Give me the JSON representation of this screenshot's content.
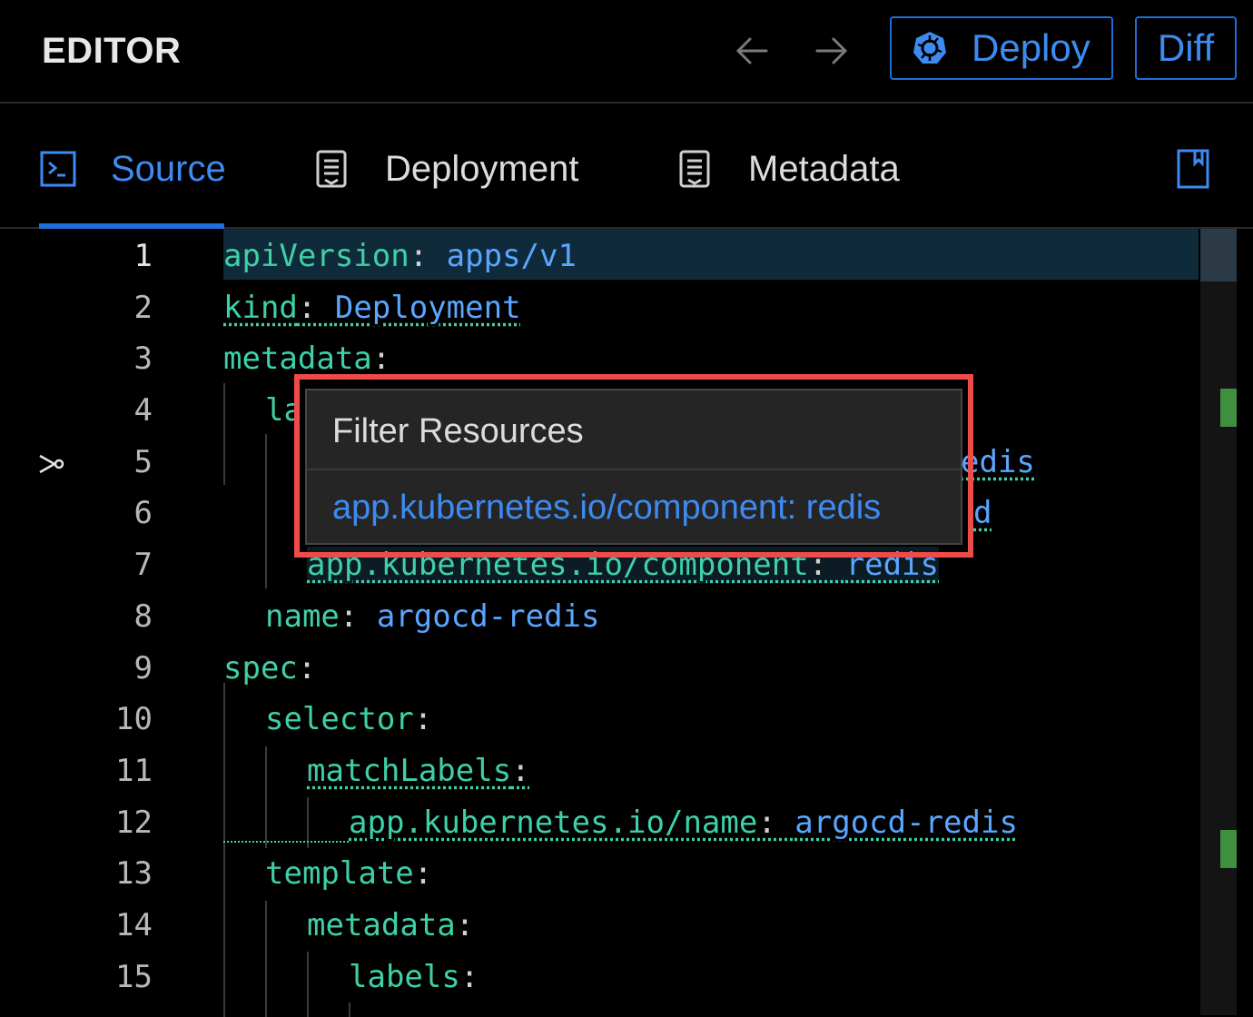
{
  "header": {
    "title": "EDITOR",
    "deploy_label": "Deploy",
    "diff_label": "Diff",
    "accent": "#1e6fd9"
  },
  "tabs": [
    {
      "label": "Source",
      "icon": "terminal-icon",
      "active": true
    },
    {
      "label": "Deployment",
      "icon": "document-icon",
      "active": false
    },
    {
      "label": "Metadata",
      "icon": "document-icon",
      "active": false
    }
  ],
  "editor": {
    "lines": [
      {
        "num": "1",
        "key": "apiVersion",
        "sep": ": ",
        "val": "apps/v1"
      },
      {
        "num": "2",
        "key": "kind",
        "sep": ": ",
        "val": "Deployment"
      },
      {
        "num": "3",
        "key": "metadata",
        "sep": ":",
        "val": ""
      },
      {
        "num": "4",
        "key": "la",
        "sep": "",
        "val": ""
      },
      {
        "num": "5",
        "key": "",
        "sep": "",
        "val": "edis"
      },
      {
        "num": "6",
        "key": "",
        "sep": "",
        "val": "d"
      },
      {
        "num": "7",
        "key": "app.kubernetes.io/component",
        "sep": ": ",
        "val": "redis"
      },
      {
        "num": "8",
        "key": "name",
        "sep": ": ",
        "val": "argocd-redis"
      },
      {
        "num": "9",
        "key": "spec",
        "sep": ":",
        "val": ""
      },
      {
        "num": "10",
        "key": "selector",
        "sep": ":",
        "val": ""
      },
      {
        "num": "11",
        "key": "matchLabels",
        "sep": ":",
        "val": ""
      },
      {
        "num": "12",
        "key": "app.kubernetes.io/name",
        "sep": ": ",
        "val": "argocd-redis"
      },
      {
        "num": "13",
        "key": "template",
        "sep": ":",
        "val": ""
      },
      {
        "num": "14",
        "key": "metadata",
        "sep": ":",
        "val": ""
      },
      {
        "num": "15",
        "key": "labels",
        "sep": ":",
        "val": ""
      }
    ]
  },
  "popup": {
    "title": "Filter Resources",
    "item": "app.kubernetes.io/component: redis"
  }
}
